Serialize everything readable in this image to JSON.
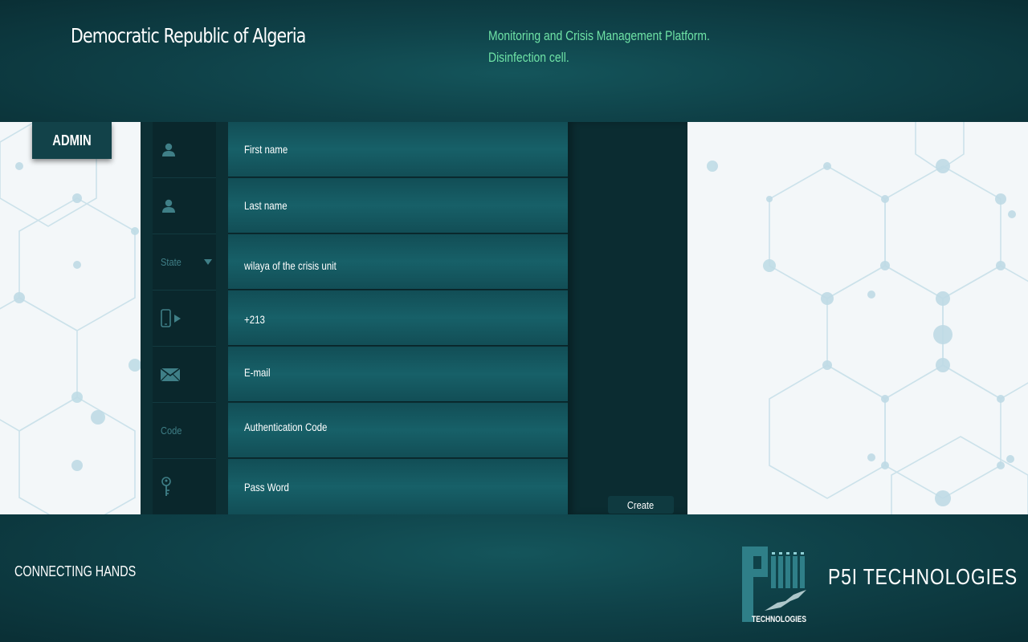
{
  "header": {
    "title": "Democratic Republic of Algeria",
    "subtitle_line1": "Monitoring and Crisis Management Platform.",
    "subtitle_line2": "Disinfection cell."
  },
  "sidebar": {
    "admin_label": "ADMIN"
  },
  "form": {
    "rows": [
      {
        "icon": "user-icon",
        "placeholder": "First name"
      },
      {
        "icon": "user-icon",
        "placeholder": "Last name"
      },
      {
        "icon_label": "State",
        "icon": "chevron-down-icon",
        "placeholder": "wilaya of the crisis unit"
      },
      {
        "icon": "phone-icon",
        "placeholder": "+213"
      },
      {
        "icon": "envelope-icon",
        "placeholder": "E-mail"
      },
      {
        "icon_label": "Code",
        "placeholder": "Authentication Code"
      },
      {
        "icon": "key-icon",
        "placeholder": "Pass Word"
      }
    ],
    "create_label": "Create"
  },
  "footer": {
    "left_text": "CONNECTING HANDS",
    "logo_text": "TECHNOLOGIES",
    "brand": "P5I TECHNOLOGIES"
  },
  "colors": {
    "accent_green": "#6fe3a6",
    "panel_dark": "#0a272c",
    "field_teal": "#176068",
    "icon_teal": "#3f7f87"
  }
}
